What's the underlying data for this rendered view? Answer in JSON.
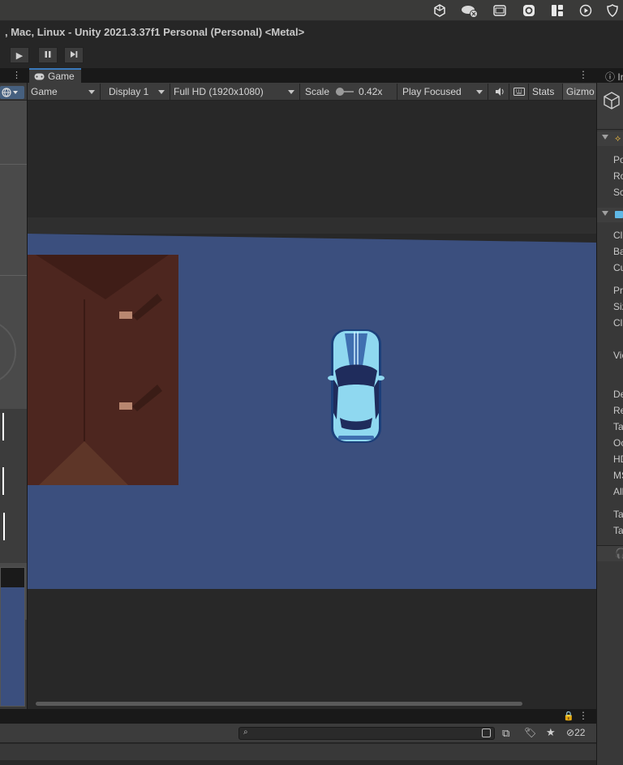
{
  "menubar": {
    "icons": [
      "unity-icon",
      "cloud-sync-icon",
      "window-icon",
      "logi-icon",
      "grid-icon",
      "play-circle-icon",
      "shield-icon"
    ]
  },
  "window": {
    "title": ", Mac, Linux - Unity 2021.3.37f1 Personal (Personal) <Metal>"
  },
  "toolbar": {
    "play": "▶",
    "pause": "⏸",
    "step": "⏭"
  },
  "game_view": {
    "tab_label": "Game",
    "mode": "Game",
    "display": "Display 1",
    "resolution": "Full HD (1920x1080)",
    "scale_label": "Scale",
    "scale_value": "0.42x",
    "scale_fraction": 0.1,
    "play_mode": "Play Focused",
    "stats_label": "Stats",
    "gizmos_label": "Gizmo"
  },
  "inspector": {
    "tab_label": "In",
    "labels": [
      "Po",
      "Ro",
      "Sc",
      "Cl",
      "Ba",
      "Cu",
      "Pr",
      "Siz",
      "Cl",
      "Vie",
      "De",
      "Re",
      "Ta",
      "Oc",
      "HD",
      "MS",
      "All",
      "Ta",
      "Ta"
    ]
  },
  "bottom": {
    "hidden_count": "22",
    "search_placeholder": ""
  },
  "colors": {
    "ground": "#3b4f7e",
    "building": "#4d261f",
    "car_body": "#8fd8f0",
    "accent": "#3a79bb"
  }
}
